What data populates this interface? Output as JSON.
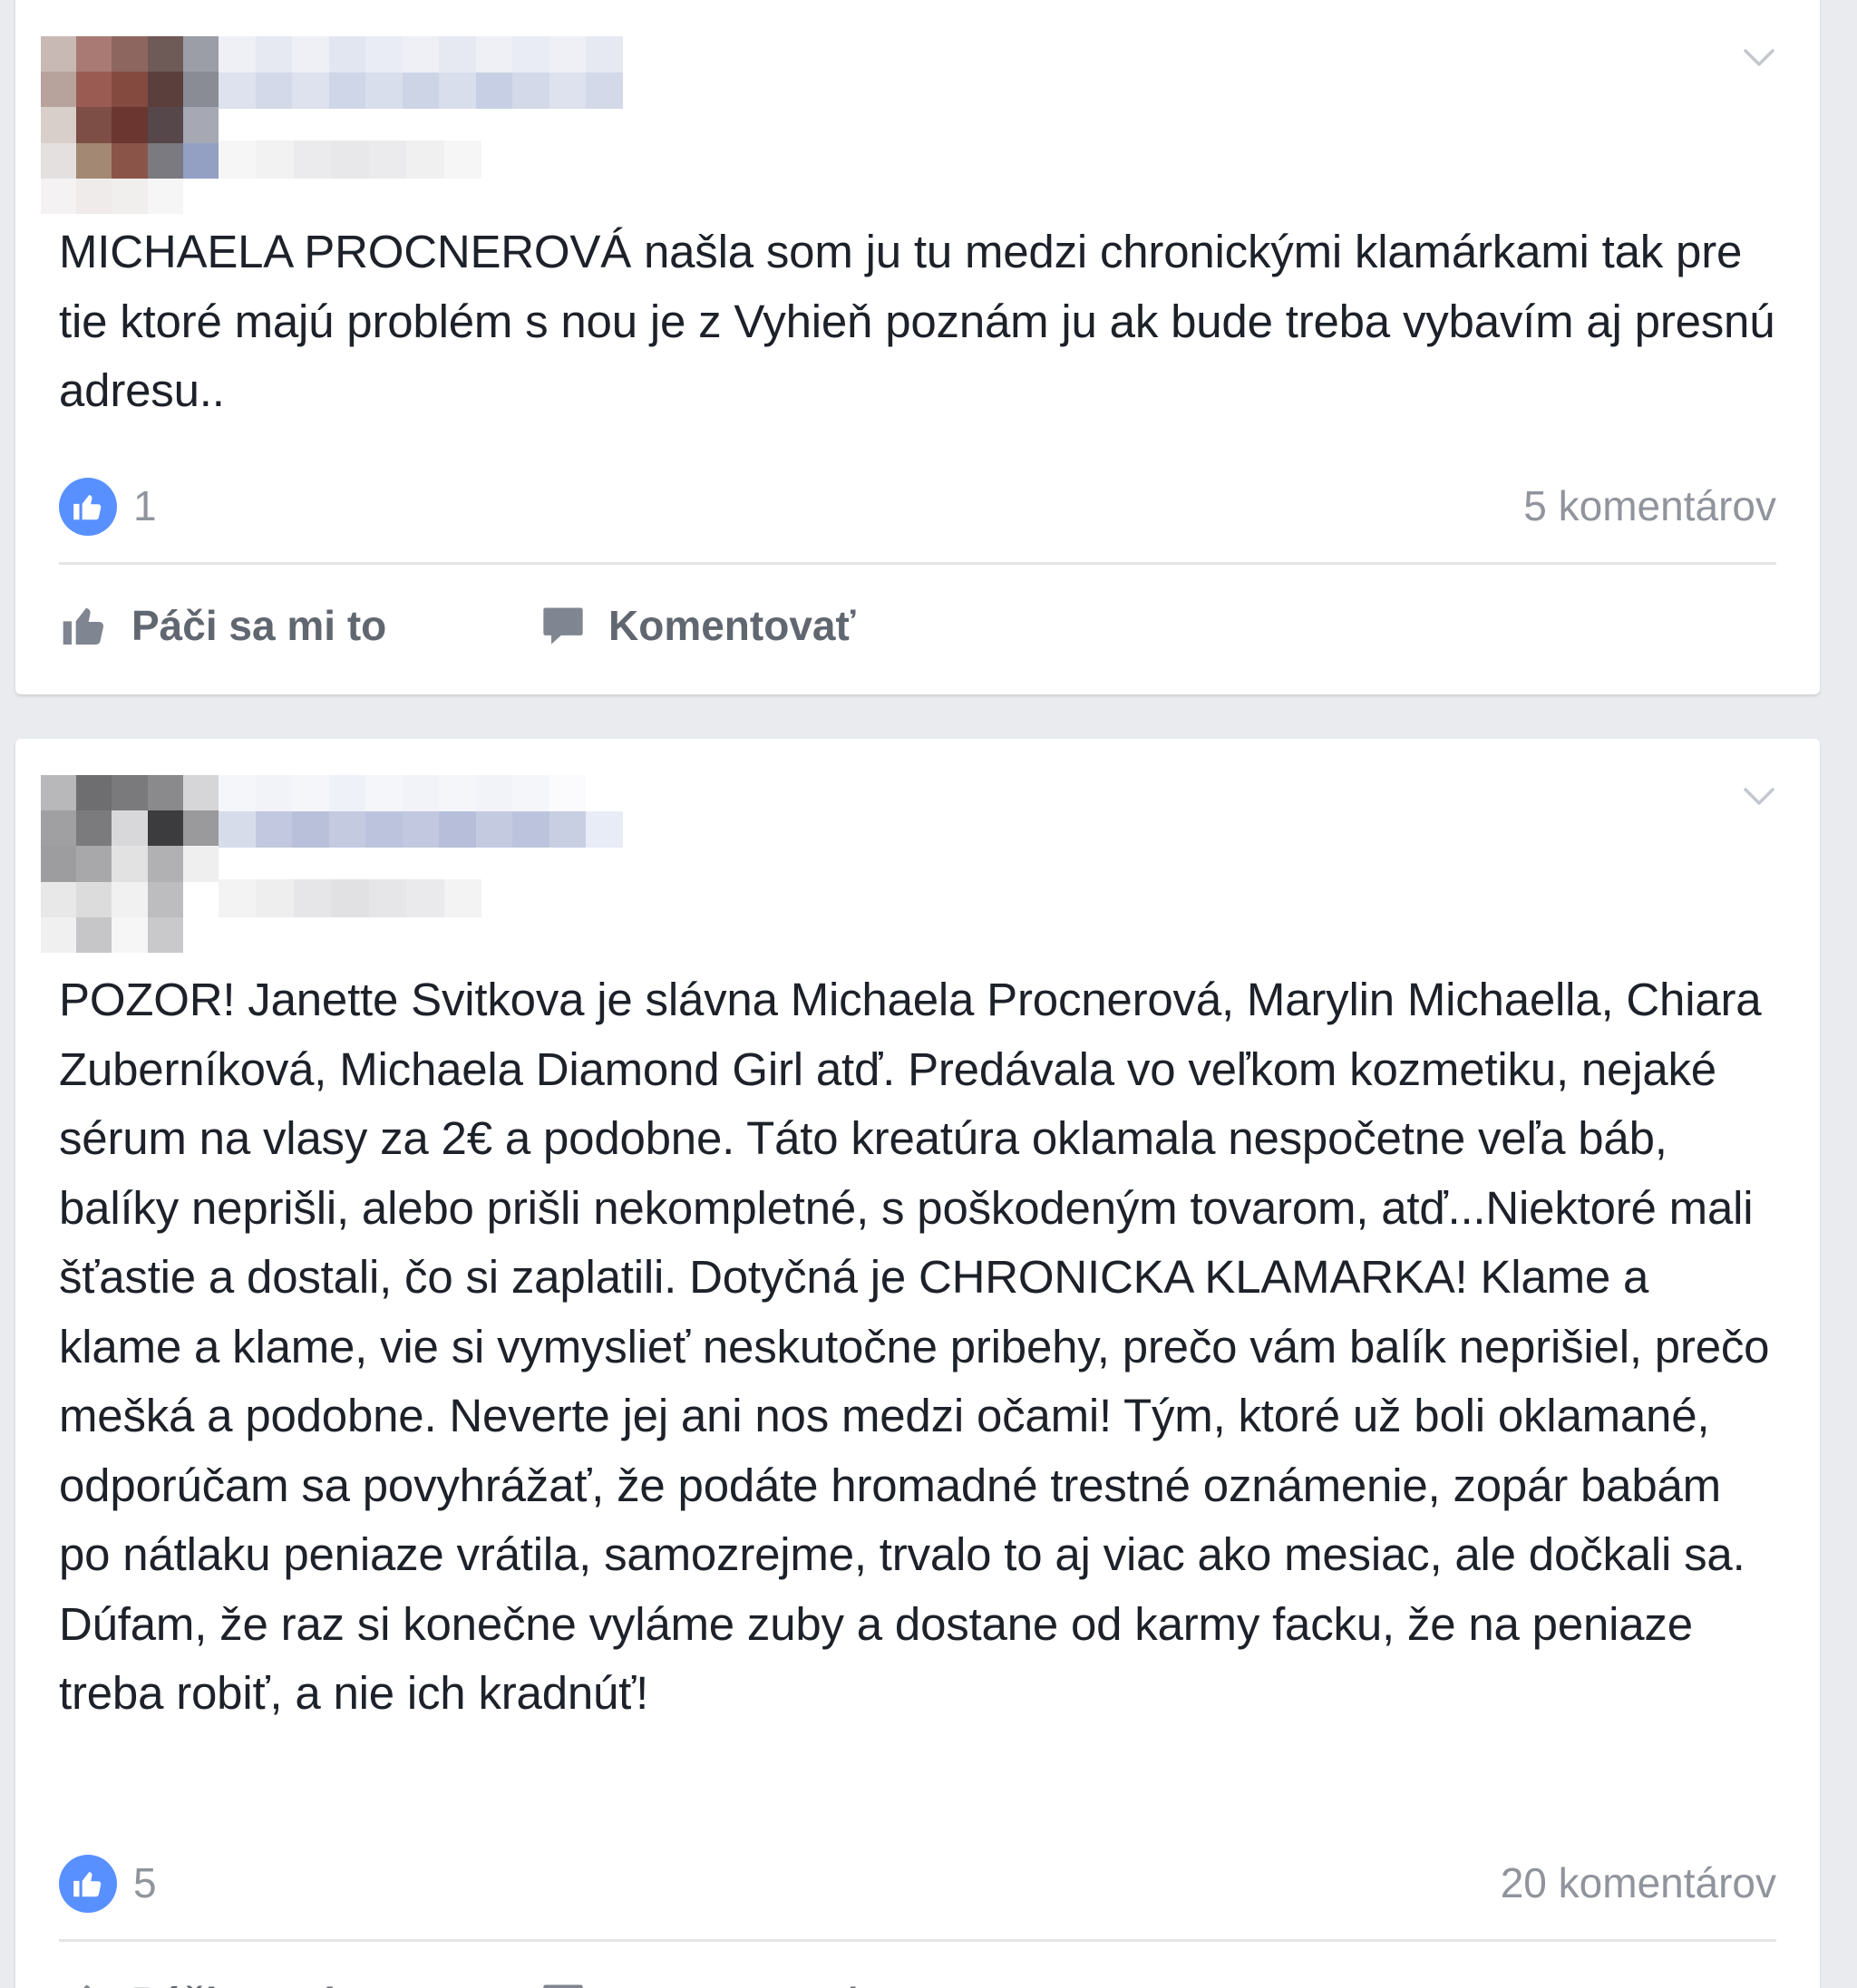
{
  "posts": [
    {
      "text": "MICHAELA PROCNEROVÁ našla som ju tu medzi chronickými klamárkami tak pre tie ktoré majú problém s nou je z Vyhieň poznám ju ak bude treba vybavím aj presnú adresu..",
      "likes": "1",
      "comments": "5 komentárov",
      "like_action": "Páči sa mi to",
      "comment_action": "Komentovať"
    },
    {
      "text": "POZOR! Janette Svitkova je slávna Michaela Procnerová, Marylin Michaella, Chiara Zuberníková, Michaela Diamond Girl atď. Predávala vo veľkom kozmetiku, nejaké sérum na vlasy za 2€ a podobne. Táto kreatúra oklamala nespočetne veľa báb, balíky neprišli, alebo prišli nekompletné, s poškodeným tovarom, atď...Niektoré mali šťastie a dostali, čo si zaplatili. Dotyčná je CHRONICKA KLAMARKA! Klame a klame a klame, vie si vymyslieť neskutočne pribehy, prečo vám balík neprišiel, prečo mešká a podobne. Neverte jej ani nos medzi očami! Tým, ktoré už boli oklamané, odporúčam sa povyhrážať, že podáte hromadné trestné oznámenie, zopár babám po nátlaku peniaze vrátila, samozrejme, trvalo to aj viac ako mesiac, ale dočkali sa. Dúfam, že raz si konečne vyláme zuby a dostane od karmy facku, že na peniaze treba robiť, a nie ich kradnúť!",
      "likes": "5",
      "comments": "20 komentárov",
      "like_action": "Páči sa mi to",
      "comment_action": "Komentovať"
    }
  ],
  "colors": {
    "background": "#e9ebee",
    "card": "#ffffff",
    "text": "#1d2129",
    "muted": "#90949c",
    "like_blue": "#5890ff",
    "action_gray": "#616770"
  },
  "icons": {
    "options": "chevron-down-icon",
    "like_badge": "thumbs-up-icon",
    "like_action": "thumbs-up-outline-icon",
    "comment_action": "speech-bubble-icon"
  }
}
